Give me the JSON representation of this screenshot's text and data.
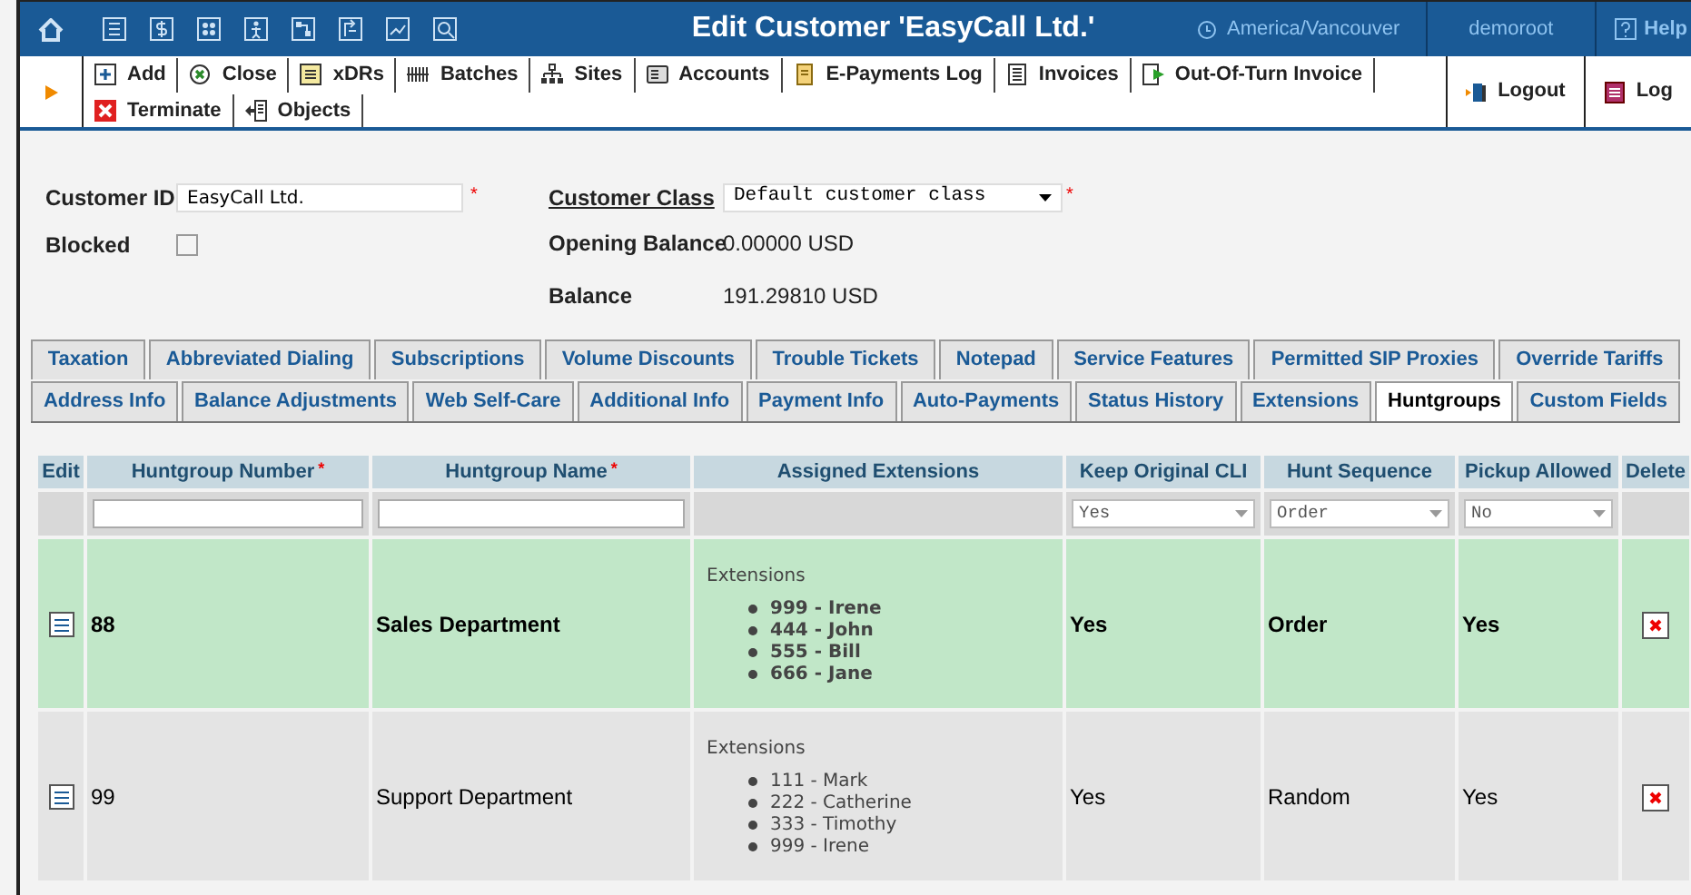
{
  "header": {
    "title": "Edit Customer 'EasyCall Ltd.'",
    "timezone": "America/Vancouver",
    "user": "demoroot",
    "help": "Help"
  },
  "toolbar": {
    "rows": [
      [
        {
          "label": "Add"
        },
        {
          "label": "Close"
        },
        {
          "label": "xDRs"
        },
        {
          "label": "Batches"
        },
        {
          "label": "Sites"
        },
        {
          "label": "Accounts"
        },
        {
          "label": "E-Payments Log"
        },
        {
          "label": "Invoices"
        },
        {
          "label": "Out-Of-Turn Invoice"
        }
      ],
      [
        {
          "label": "Terminate"
        },
        {
          "label": "Objects"
        }
      ]
    ],
    "right": [
      {
        "label": "Logout"
      },
      {
        "label": "Log"
      }
    ]
  },
  "form": {
    "customer_id": {
      "label": "Customer ID",
      "value": "EasyCall Ltd.",
      "required_mark": "*"
    },
    "blocked": {
      "label": "Blocked",
      "checked": false
    },
    "customer_class": {
      "label": "Customer Class",
      "value": "Default customer class",
      "required_mark": "*"
    },
    "opening_balance": {
      "label": "Opening Balance",
      "value": "0.00000 USD"
    },
    "balance": {
      "label": "Balance",
      "value": "191.29810 USD"
    }
  },
  "tabs": [
    [
      {
        "label": "Taxation",
        "selected": false
      },
      {
        "label": "Abbreviated Dialing",
        "selected": false
      },
      {
        "label": "Subscriptions",
        "selected": false
      },
      {
        "label": "Volume Discounts",
        "selected": false
      },
      {
        "label": "Trouble Tickets",
        "selected": false
      },
      {
        "label": "Notepad",
        "selected": false
      },
      {
        "label": "Service Features",
        "selected": false
      },
      {
        "label": "Permitted SIP Proxies",
        "selected": false
      },
      {
        "label": "Override Tariffs",
        "selected": false
      }
    ],
    [
      {
        "label": "Address Info",
        "selected": false
      },
      {
        "label": "Balance Adjustments",
        "selected": false
      },
      {
        "label": "Web Self-Care",
        "selected": false
      },
      {
        "label": "Additional Info",
        "selected": false
      },
      {
        "label": "Payment Info",
        "selected": false
      },
      {
        "label": "Auto-Payments",
        "selected": false
      },
      {
        "label": "Status History",
        "selected": false
      },
      {
        "label": "Extensions",
        "selected": false
      },
      {
        "label": "Huntgroups",
        "selected": true
      },
      {
        "label": "Custom Fields",
        "selected": false
      }
    ]
  ],
  "table": {
    "columns": [
      {
        "label": "Edit"
      },
      {
        "label": "Huntgroup Number",
        "required_mark": "*"
      },
      {
        "label": "Huntgroup Name",
        "required_mark": "*"
      },
      {
        "label": "Assigned Extensions"
      },
      {
        "label": "Keep Original CLI"
      },
      {
        "label": "Hunt Sequence"
      },
      {
        "label": "Pickup Allowed"
      },
      {
        "label": "Delete"
      }
    ],
    "filter_row": [
      {
        "kind": "empty"
      },
      {
        "kind": "text"
      },
      {
        "kind": "text"
      },
      {
        "kind": "empty"
      },
      {
        "kind": "select",
        "value": "Yes"
      },
      {
        "kind": "select",
        "value": "Order"
      },
      {
        "kind": "select",
        "value": "No"
      },
      {
        "kind": "empty"
      }
    ],
    "rows": [
      {
        "selected": true,
        "number": "88",
        "name": "Sales Department",
        "extensions_heading": "Extensions",
        "extensions": [
          "999 - Irene",
          "444 - John",
          "555 - Bill",
          "666 - Jane"
        ],
        "keep_original_cli": "Yes",
        "hunt_sequence": "Order",
        "pickup_allowed": "Yes"
      },
      {
        "selected": false,
        "number": "99",
        "name": "Support Department",
        "extensions_heading": "Extensions",
        "extensions": [
          "111 - Mark",
          "222 - Catherine",
          "333 - Timothy",
          "999 - Irene"
        ],
        "keep_original_cli": "Yes",
        "hunt_sequence": "Random",
        "pickup_allowed": "Yes"
      }
    ]
  }
}
